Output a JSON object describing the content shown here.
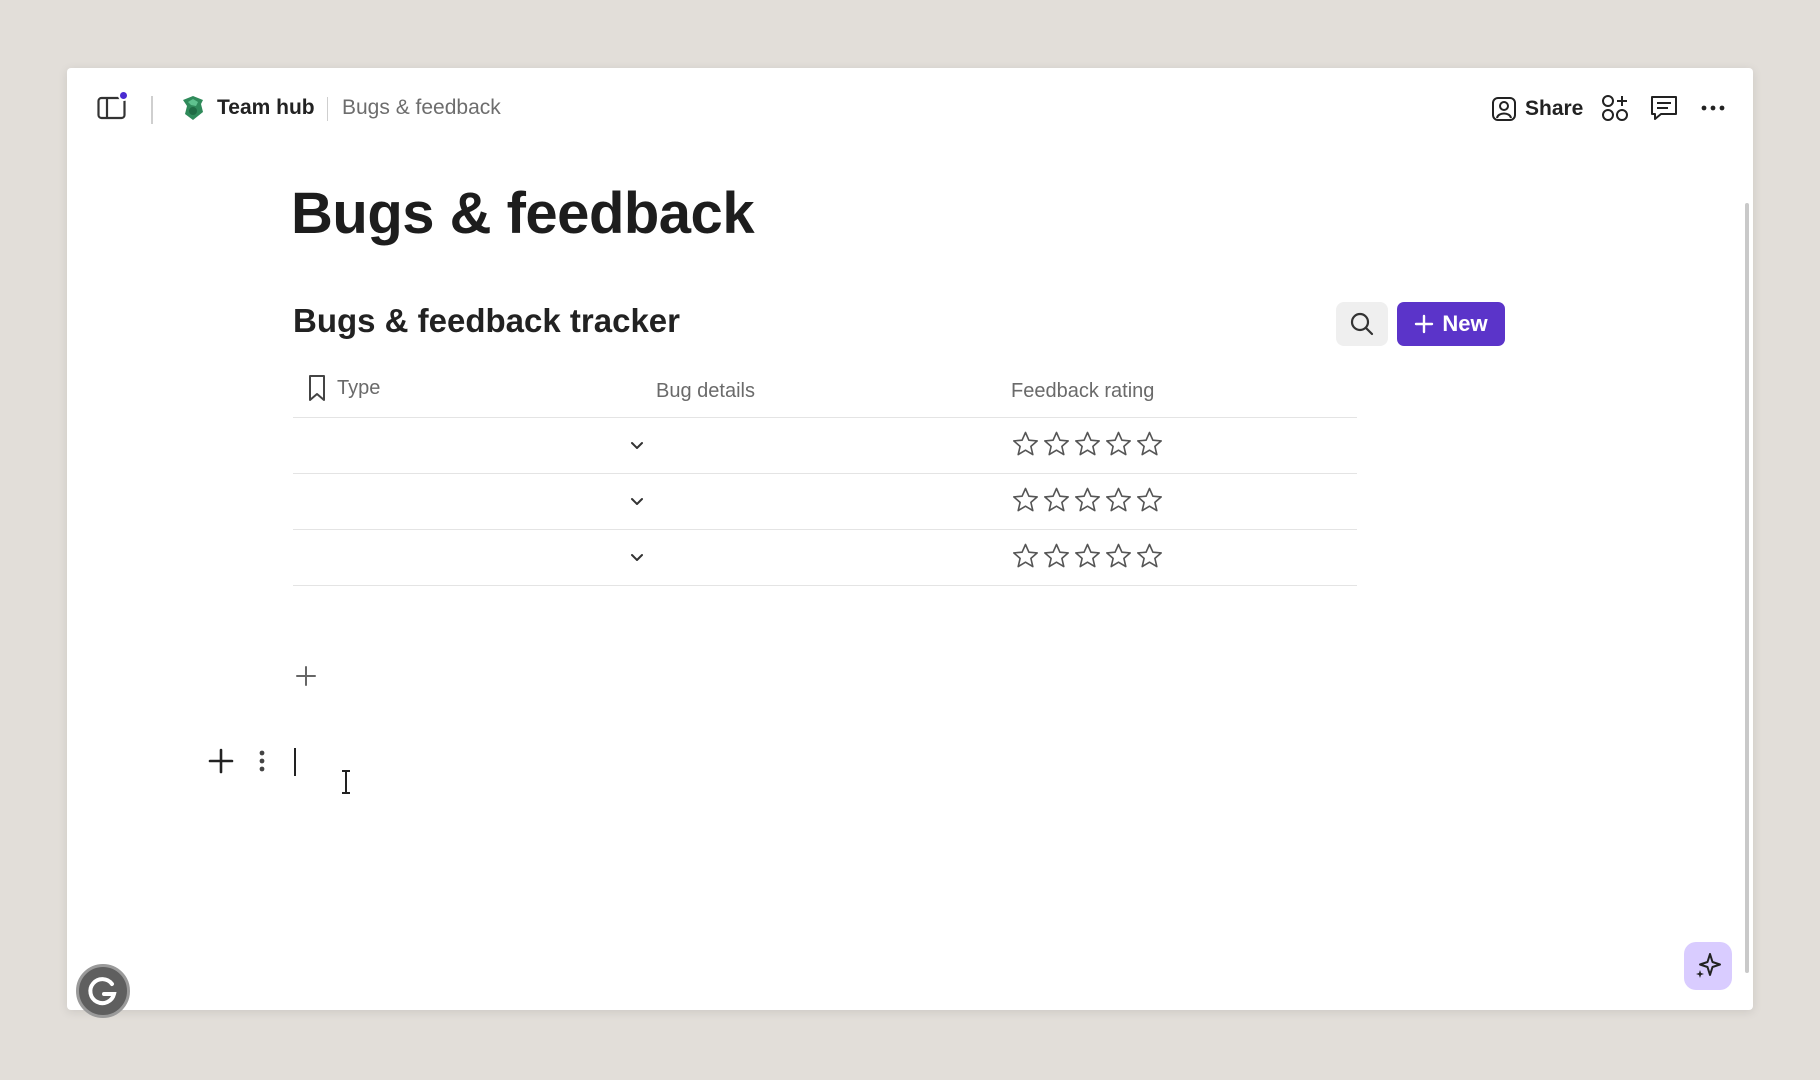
{
  "topbar": {
    "hub_name": "Team hub",
    "page_name": "Bugs & feedback",
    "share_label": "Share",
    "notification_color": "#4a2bd1"
  },
  "page": {
    "title": "Bugs & feedback"
  },
  "tracker": {
    "title": "Bugs & feedback tracker",
    "new_label": "New",
    "accent_color": "#5b34c9",
    "columns": [
      {
        "label": "Type",
        "icon": "bookmark-icon"
      },
      {
        "label": "Bug details"
      },
      {
        "label": "Feedback rating"
      }
    ],
    "rows": [
      {
        "type": "",
        "bug_details": "",
        "rating": 0,
        "rating_max": 5
      },
      {
        "type": "",
        "bug_details": "",
        "rating": 0,
        "rating_max": 5
      },
      {
        "type": "",
        "bug_details": "",
        "rating": 0,
        "rating_max": 5
      }
    ]
  },
  "icons": {
    "sidebar": "sidebar-toggle-icon",
    "hub": "hub-logo-icon",
    "share": "person-icon",
    "apps": "apps-icon",
    "comments": "comment-icon",
    "more": "more-icon",
    "search": "search-icon",
    "ai": "sparkle-icon",
    "grammarly": "grammarly-icon"
  }
}
